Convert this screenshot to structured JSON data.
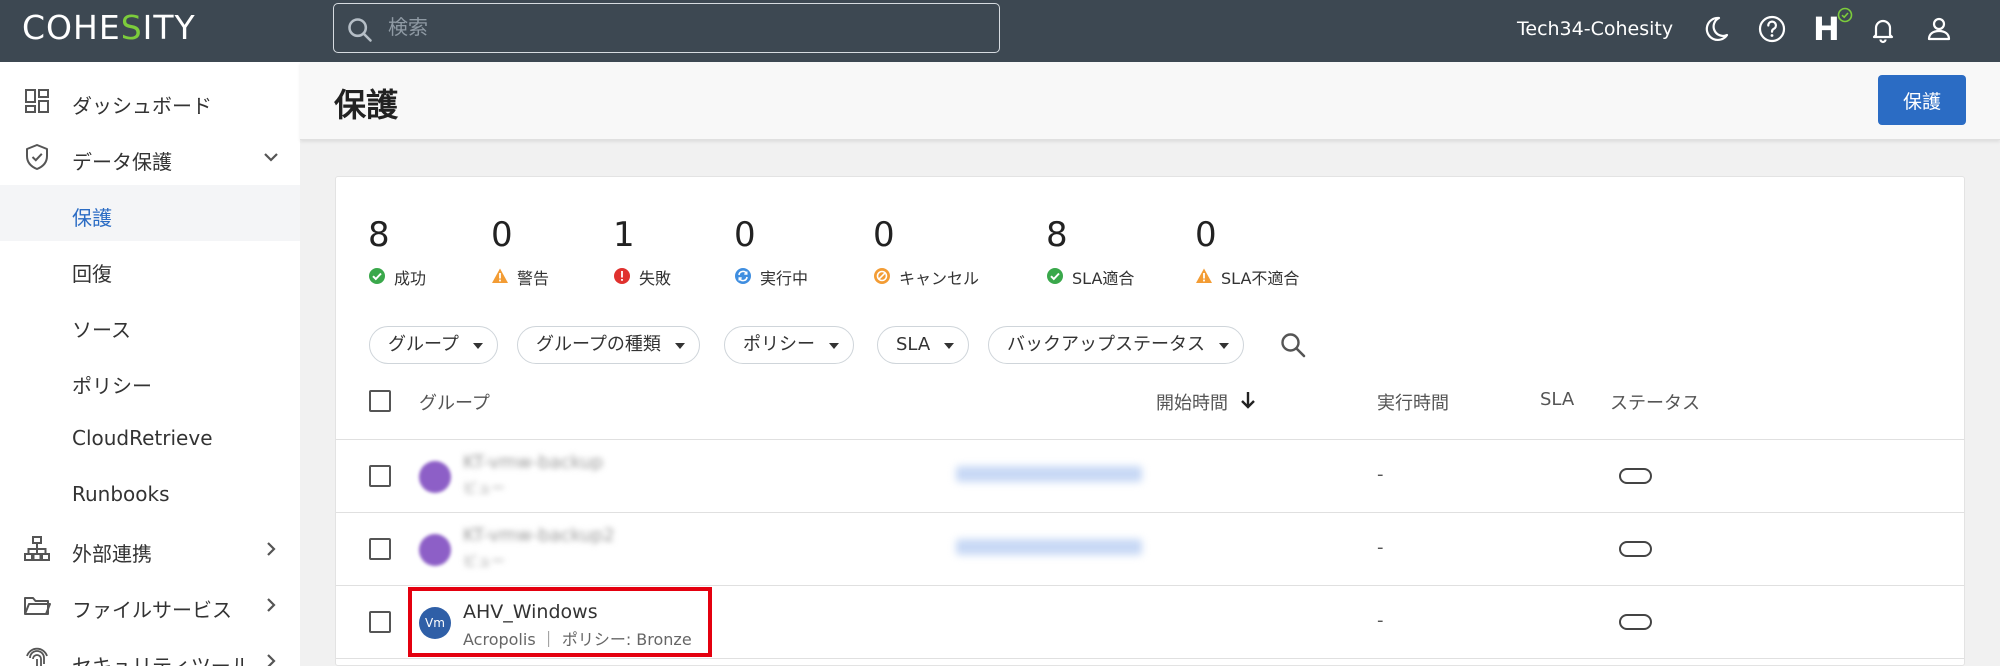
{
  "topbar": {
    "logo": "COHESITY",
    "search_placeholder": "検索",
    "cluster_name": "Tech34-Cohesity",
    "helios_letter": "H"
  },
  "sidebar": {
    "items": [
      {
        "label": "ダッシュボード",
        "icon": "dashboard-icon"
      },
      {
        "label": "データ保護",
        "icon": "shield-icon",
        "expanded": true
      },
      {
        "label": "保護",
        "active": true
      },
      {
        "label": "回復"
      },
      {
        "label": "ソース"
      },
      {
        "label": "ポリシー"
      },
      {
        "label": "CloudRetrieve"
      },
      {
        "label": "Runbooks"
      },
      {
        "label": "外部連携",
        "icon": "hierarchy-icon"
      },
      {
        "label": "ファイルサービス",
        "icon": "folder-icon"
      },
      {
        "label": "セキュリティツール",
        "icon": "fingerprint-icon"
      }
    ]
  },
  "header": {
    "title": "保護",
    "protect_button": "保護"
  },
  "stats": [
    {
      "value": "8",
      "label": "成功",
      "color": "#3aa84b"
    },
    {
      "value": "0",
      "label": "警告",
      "color": "#f39c34"
    },
    {
      "value": "1",
      "label": "失敗",
      "color": "#e0312e"
    },
    {
      "value": "0",
      "label": "実行中",
      "color": "#3f8ee0"
    },
    {
      "value": "0",
      "label": "キャンセル",
      "color": "#f39c34"
    },
    {
      "value": "8",
      "label": "SLA適合",
      "color": "#3aa84b"
    },
    {
      "value": "0",
      "label": "SLA不適合",
      "color": "#f39c34"
    }
  ],
  "filters": [
    "グループ",
    "グループの種類",
    "ポリシー",
    "SLA",
    "バックアップステータス"
  ],
  "table": {
    "headers": {
      "group": "グループ",
      "start_time": "開始時間",
      "run_time": "実行時間",
      "sla": "SLA",
      "status": "ステータス"
    },
    "rows": [
      {
        "name": "KT-vmw-backup",
        "sub": "ビュー",
        "run_time": "-"
      },
      {
        "name": "KT-vmw-backup2",
        "sub": "ビュー",
        "run_time": "-"
      },
      {
        "name": "AHV_Windows",
        "sub": "Acropolis ｜ ポリシー: Bronze",
        "avatar": "Vm",
        "run_time": "-"
      }
    ]
  }
}
